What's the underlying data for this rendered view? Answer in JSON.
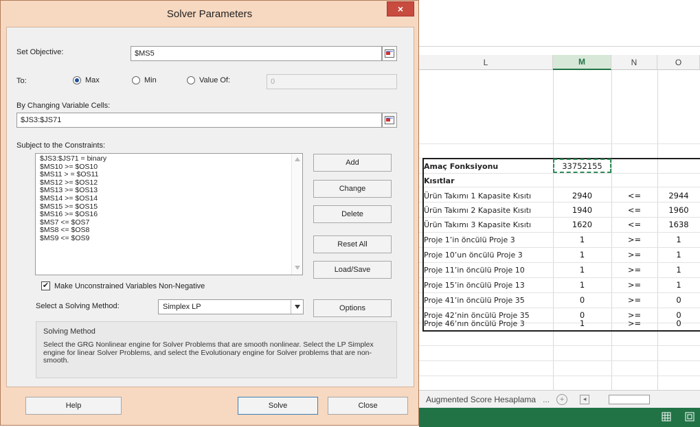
{
  "dialog": {
    "title": "Solver Parameters",
    "close_glyph": "×",
    "set_objective_label": "Set Objective:",
    "set_objective_value": "$MS5",
    "to_label": "To:",
    "radio_max": "Max",
    "radio_min": "Min",
    "radio_value_of": "Value Of:",
    "value_of_field": "0",
    "changing_cells_label": "By Changing Variable Cells:",
    "changing_cells_value": "$JS3:$JS71",
    "constraints_label": "Subject to the Constraints:",
    "constraints": [
      "$JS3:$JS71 = binary",
      "$MS10 >= $OS10",
      "$MS11 > = $OS11",
      "$MS12 >= $OS12",
      "$MS13 >= $OS13",
      "$MS14 >= $OS14",
      "$MS15 >= $OS15",
      "$MS16 >= $OS16",
      "$MS7 <= $OS7",
      "$MS8 <= $OS8",
      "$MS9 <= $OS9"
    ],
    "buttons": {
      "add": "Add",
      "change": "Change",
      "delete": "Delete",
      "reset_all": "Reset All",
      "load_save": "Load/Save",
      "options": "Options",
      "help": "Help",
      "solve": "Solve",
      "close": "Close"
    },
    "checkbox_label": "Make Unconstrained Variables Non-Negative",
    "checkbox_mark": "✔",
    "solving_method_label": "Select a Solving Method:",
    "solving_method_value": "Simplex LP",
    "method_box_title": "Solving Method",
    "method_box_text": "Select the GRG Nonlinear engine for Solver Problems that are smooth nonlinear. Select the LP Simplex engine for linear Solver Problems, and select the Evolutionary engine for Solver problems that are non-smooth."
  },
  "excel": {
    "columns": [
      "L",
      "M",
      "N",
      "O"
    ],
    "selected_column": "M",
    "objective_label": "Amaç Fonksiyonu",
    "objective_value": "33752155",
    "constraints_heading": "Kısıtlar",
    "rows": [
      {
        "label": "Ürün Takımı 1 Kapasite Kısıtı",
        "m": "2940",
        "n": "<=",
        "o": "2944"
      },
      {
        "label": "Ürün Takımı 2 Kapasite Kısıtı",
        "m": "1940",
        "n": "<=",
        "o": "1960"
      },
      {
        "label": "Ürün Takımı 3 Kapasite Kısıtı",
        "m": "1620",
        "n": "<=",
        "o": "1638"
      },
      {
        "label": "Proje 1’in öncülü Proje 3",
        "m": "1",
        "n": ">=",
        "o": "1"
      },
      {
        "label": "Proje 10’un öncülü Proje 3",
        "m": "1",
        "n": ">=",
        "o": "1"
      },
      {
        "label": "Proje 11’in öncülü Proje 10",
        "m": "1",
        "n": ">=",
        "o": "1"
      },
      {
        "label": "Proje 15’in öncülü Proje 13",
        "m": "1",
        "n": ">=",
        "o": "1"
      },
      {
        "label": "Proje 41’in öncülü Proje 35",
        "m": "0",
        "n": ">=",
        "o": "0"
      },
      {
        "label": "Proje 42’nin öncülü Proje 35",
        "m": "0",
        "n": ">=",
        "o": "0"
      },
      {
        "label": "Proje 46’nın öncülü Proje 3",
        "m": "1",
        "n": ">=",
        "o": "0"
      }
    ],
    "sheet_tab": "Augmented Score Hesaplama",
    "sheet_more": "...",
    "sheet_add": "+",
    "sheet_nav": "◂",
    "status_icons": [
      "grid-icon",
      "page-layout-icon"
    ]
  },
  "colors": {
    "dialog_frame": "#f7d8c0",
    "close_button": "#c74b3e",
    "excel_green": "#217346",
    "selection_dashed": "#2e8b57"
  }
}
